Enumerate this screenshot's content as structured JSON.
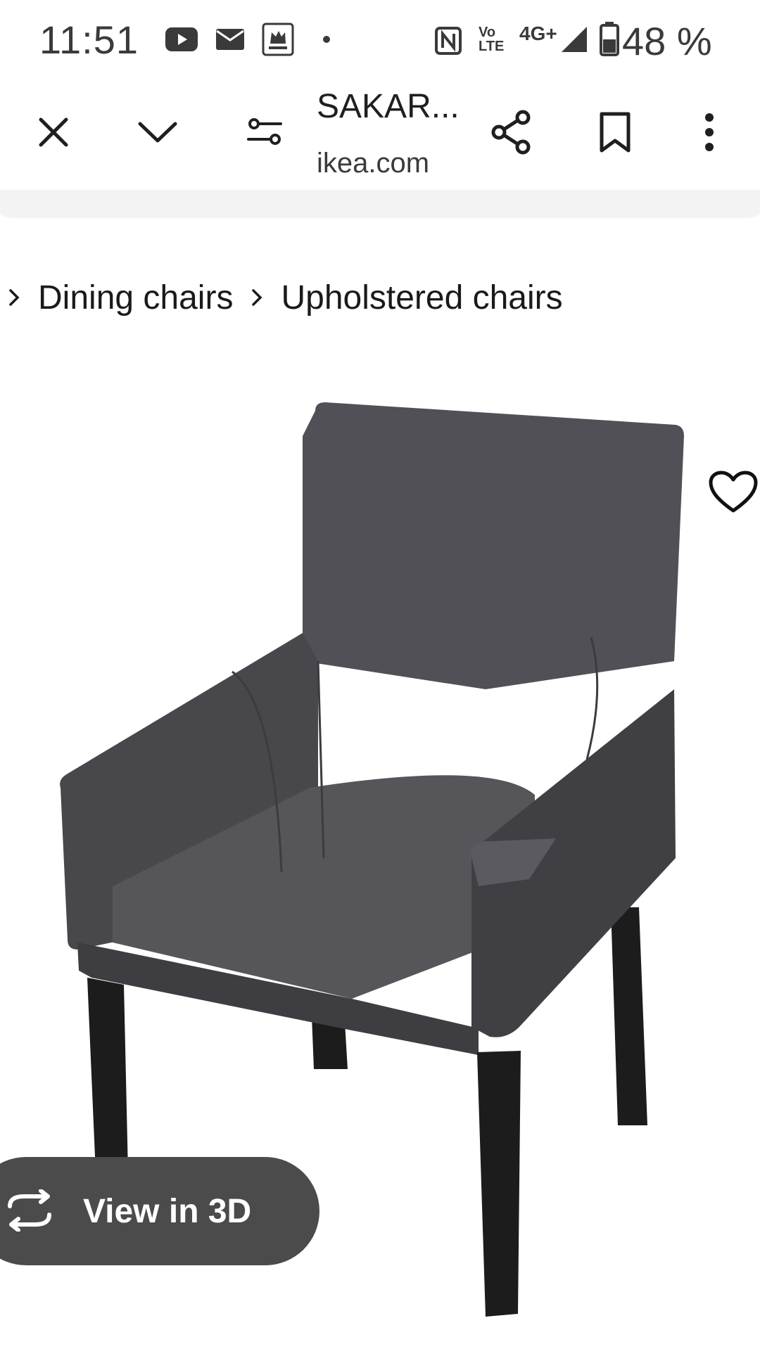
{
  "status_bar": {
    "time": "11:51",
    "network": "4G+",
    "volte": "Vo",
    "lte": "LTE",
    "battery_percent": "48 %",
    "notification_icons": [
      "youtube-icon",
      "mail-icon",
      "mega-image-app-icon",
      "dot-icon"
    ],
    "system_icons": [
      "nfc-icon",
      "volte-icon",
      "signal-icon",
      "battery-icon"
    ]
  },
  "toolbar": {
    "title": "SAKAR...",
    "domain": "ikea.com",
    "icons": [
      "close-icon",
      "chevron-down-icon",
      "tune-icon",
      "share-icon",
      "bookmark-icon",
      "more-vert-icon"
    ]
  },
  "breadcrumb": {
    "items": [
      "Dining chairs",
      "Upholstered chairs"
    ]
  },
  "product": {
    "image_subject": "grey upholstered armchair with black legs",
    "favourite_icon": "heart-icon"
  },
  "view_3d": {
    "label": "View in 3D",
    "icon": "rotate-3d-icon"
  },
  "colors": {
    "upholstery": "#4a4a4f",
    "legs": "#1c1c1c",
    "pill_bg": "#4b4b4b"
  }
}
